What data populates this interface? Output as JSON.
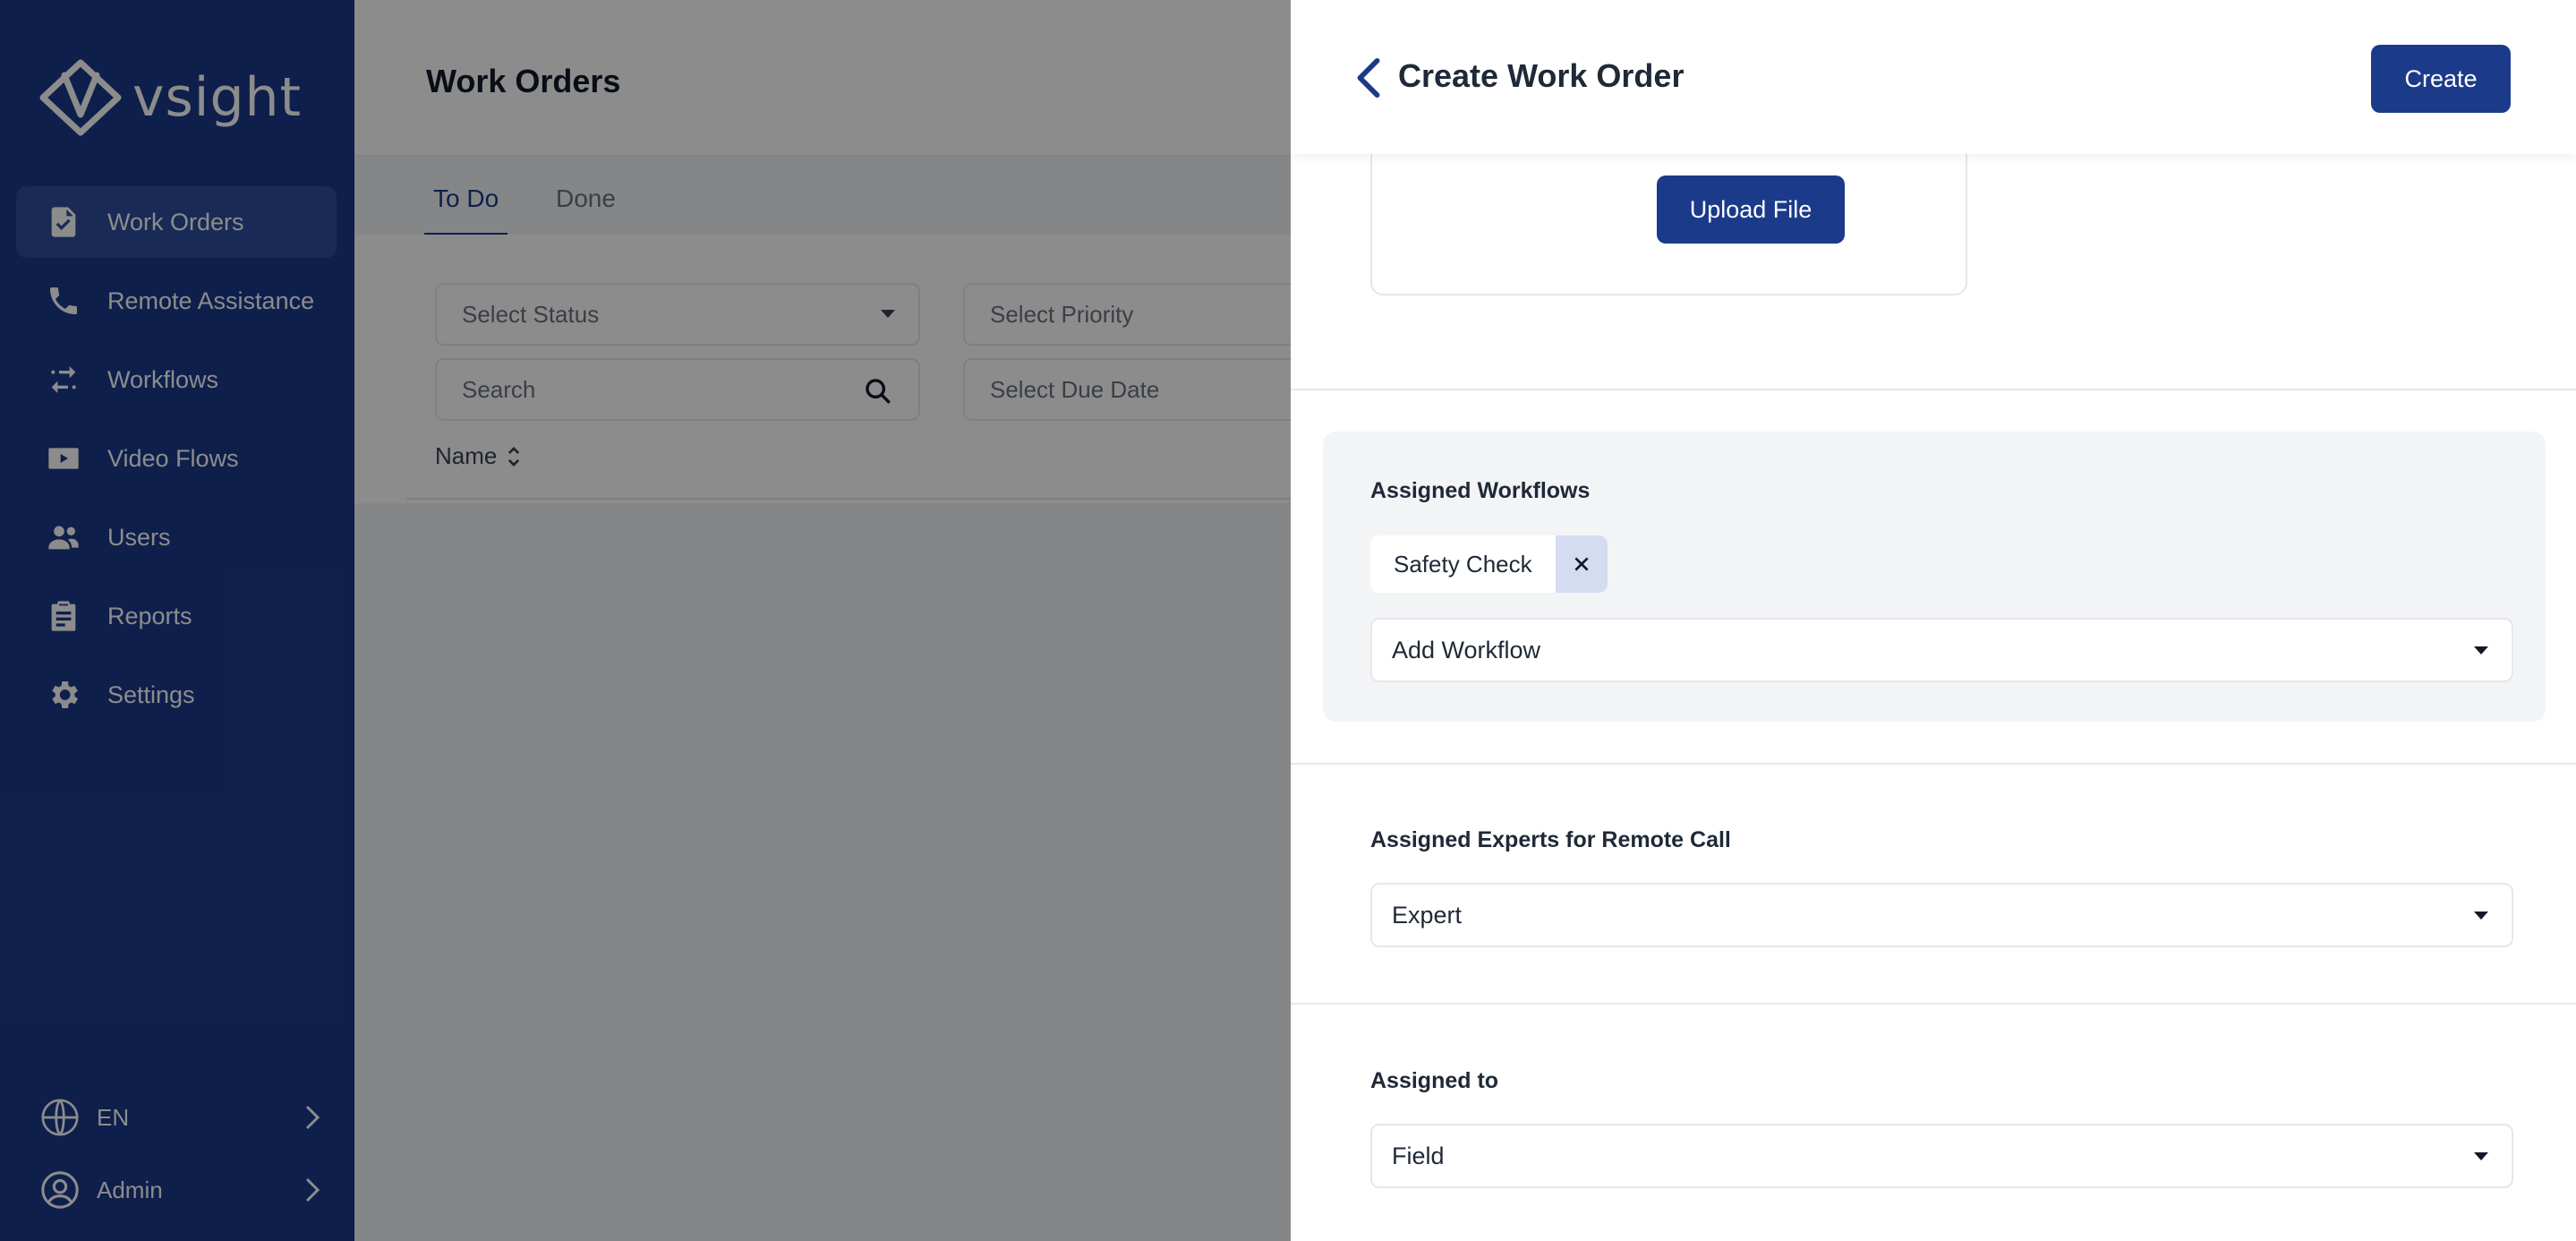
{
  "brand": {
    "name": "vsight"
  },
  "sidebar": {
    "items": [
      {
        "label": "Work Orders",
        "icon": "file-check-icon",
        "active": true
      },
      {
        "label": "Remote Assistance",
        "icon": "phone-icon",
        "active": false
      },
      {
        "label": "Workflows",
        "icon": "arrows-exchange-icon",
        "active": false
      },
      {
        "label": "Video Flows",
        "icon": "video-play-icon",
        "active": false
      },
      {
        "label": "Users",
        "icon": "users-icon",
        "active": false
      },
      {
        "label": "Reports",
        "icon": "clipboard-list-icon",
        "active": false
      },
      {
        "label": "Settings",
        "icon": "gear-icon",
        "active": false
      }
    ],
    "language": {
      "label": "EN",
      "icon": "globe-icon"
    },
    "account": {
      "label": "Admin",
      "icon": "user-circle-icon"
    }
  },
  "main": {
    "title": "Work Orders",
    "tabs": [
      {
        "label": "To Do",
        "active": true
      },
      {
        "label": "Done",
        "active": false
      }
    ],
    "filters": {
      "status_placeholder": "Select Status",
      "priority_placeholder": "Select Priority",
      "search_placeholder": "Search",
      "due_date_placeholder": "Select Due Date"
    },
    "columns": {
      "name": "Name"
    }
  },
  "drawer": {
    "title": "Create Work Order",
    "create_label": "Create",
    "upload_label": "Upload File",
    "assigned_workflows": {
      "label": "Assigned Workflows",
      "chips": [
        "Safety Check"
      ],
      "add_placeholder": "Add Workflow"
    },
    "assigned_experts": {
      "label": "Assigned Experts for Remote Call",
      "value": "Expert"
    },
    "assigned_to": {
      "label": "Assigned to",
      "value": "Field"
    }
  },
  "colors": {
    "brand_primary": "#1b3a8a",
    "sidebar_active": "#2c4d9c",
    "chip_close_bg": "#d5dcf2",
    "overlay": "rgba(0,0,0,0.45)"
  }
}
